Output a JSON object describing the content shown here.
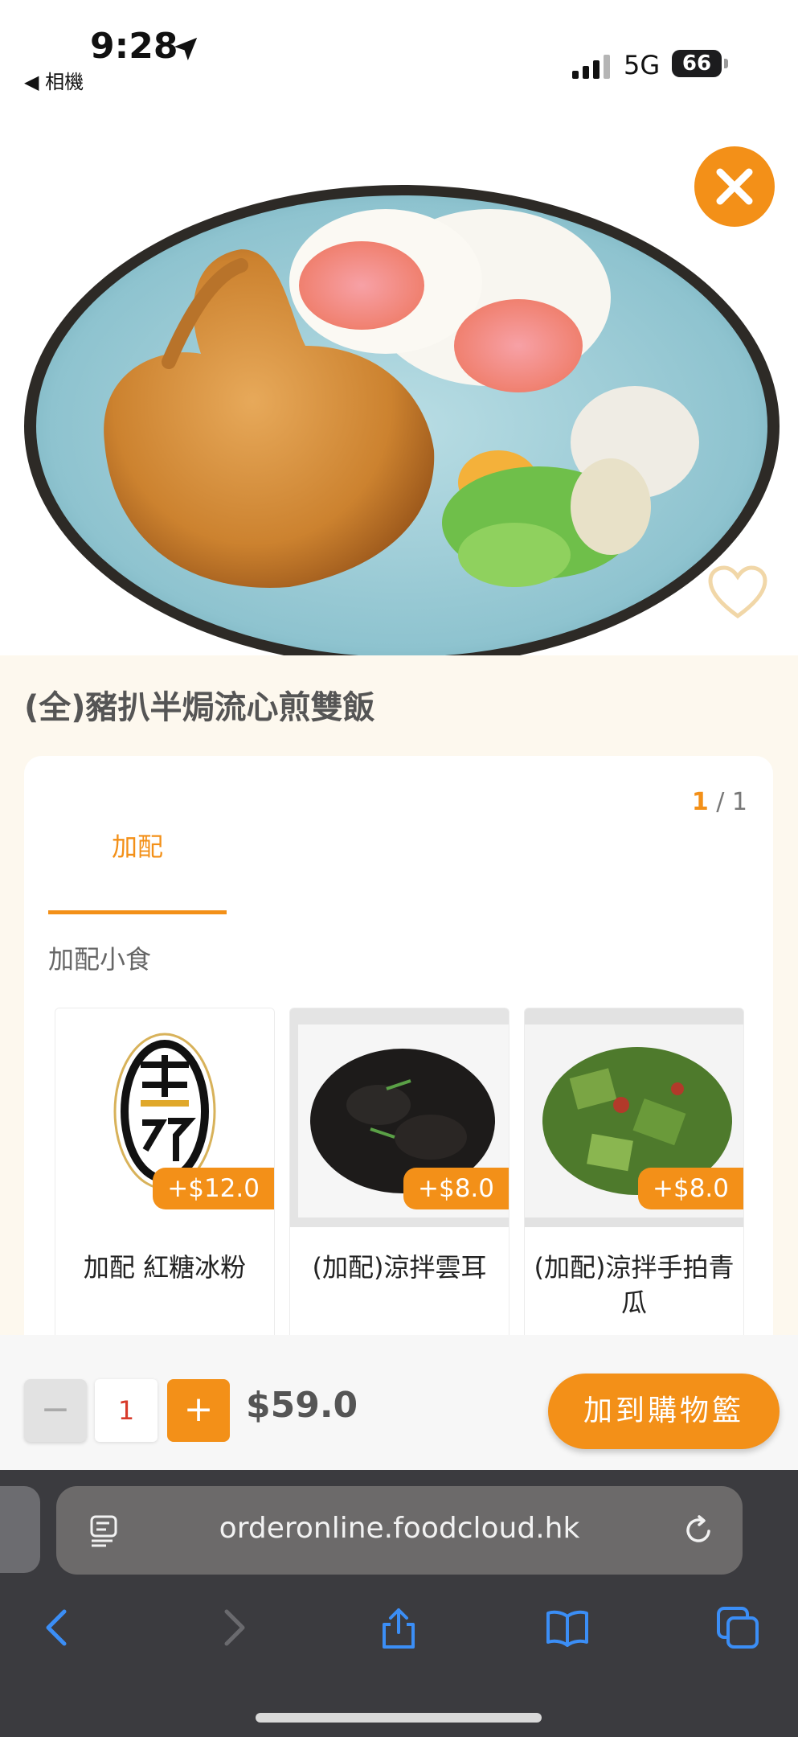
{
  "status_bar": {
    "time": "9:28",
    "back_app": "◀ 相機",
    "network": "5G",
    "battery": "66"
  },
  "hero": {
    "image_description_icon": "food-photo",
    "close_icon": "close-icon",
    "favorite_icon": "heart-icon"
  },
  "product": {
    "title": "(全)豬扒半焗流心煎雙飯"
  },
  "pager": {
    "current": "1",
    "separator": " / ",
    "total": "1"
  },
  "tab": {
    "label": "加配"
  },
  "section": {
    "label": "加配小食"
  },
  "addons": [
    {
      "price": "+$12.0",
      "name": "加配 紅糖冰粉"
    },
    {
      "price": "+$8.0",
      "name": "(加配)涼拌雲耳"
    },
    {
      "price": "+$8.0",
      "name": "(加配)涼拌手拍青瓜"
    }
  ],
  "bottom_bar": {
    "minus_label": "−",
    "quantity": "1",
    "plus_label": "+",
    "total_price": "$59.0",
    "add_to_cart": "加到購物籃"
  },
  "browser": {
    "url": "orderonline.foodcloud.hk"
  },
  "colors": {
    "accent": "#f39018",
    "cream_bg": "#fdf8ee",
    "browser_bg": "#3b3b3f",
    "link_blue": "#3b8ef6"
  }
}
